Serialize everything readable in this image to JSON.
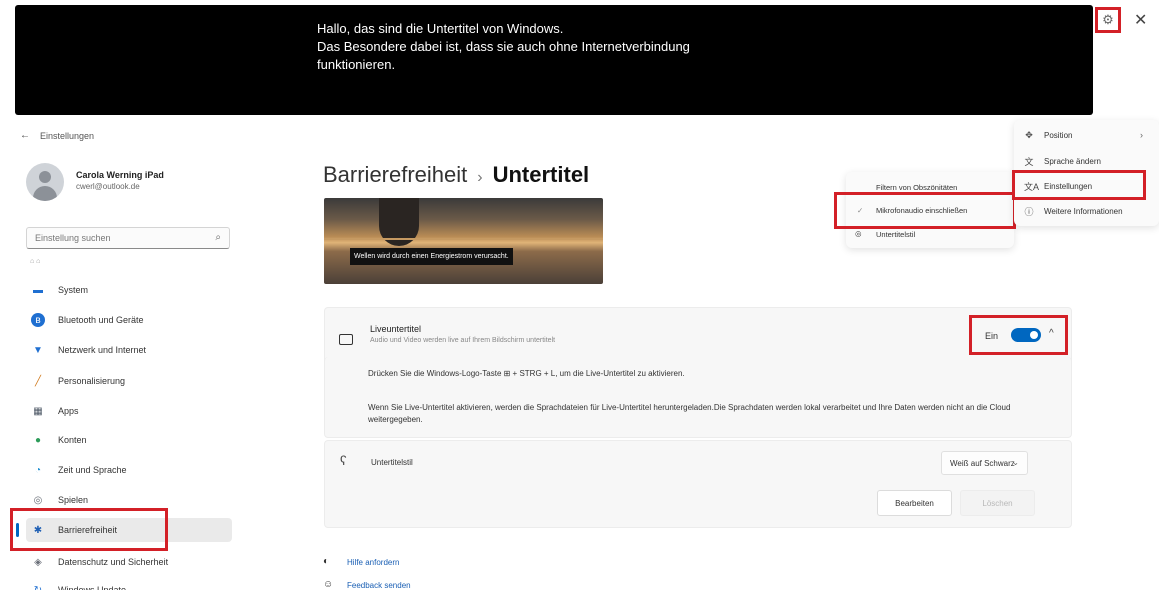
{
  "caption": {
    "lines": [
      "Hallo, das sind die Untertitel von Windows.",
      "Das Besondere dabei ist, dass sie auch ohne Internetverbindung",
      "funktionieren."
    ],
    "gear_icon": "⚙",
    "close_icon": "✕"
  },
  "window": {
    "back_icon": "←",
    "title": "Einstellungen"
  },
  "user": {
    "name": "Carola Werning iPad",
    "email": "cwerl@outlook.de"
  },
  "search": {
    "placeholder": "Einstellung suchen",
    "icon": "⌕"
  },
  "sidebar": {
    "cut_item": "⌂ ⌂",
    "items": [
      {
        "label": "System",
        "icon": "▬",
        "color": "#1f6fd1"
      },
      {
        "label": "Bluetooth und Geräte",
        "icon": "ʙ",
        "color": "#1f6fd1"
      },
      {
        "label": "Netzwerk und Internet",
        "icon": "▼",
        "color": "#1f6fd1"
      },
      {
        "label": "Personalisierung",
        "icon": "╱",
        "color": "#d17b1f"
      },
      {
        "label": "Apps",
        "icon": "▦",
        "color": "#4a5563"
      },
      {
        "label": "Konten",
        "icon": "●",
        "color": "#2d9c5a"
      },
      {
        "label": "Zeit und Sprache",
        "icon": "◔",
        "color": "#1f8fd1"
      },
      {
        "label": "Spielen",
        "icon": "◎",
        "color": "#6a6f78"
      },
      {
        "label": "Barrierefreiheit",
        "icon": "✱",
        "color": "#1f5fb4"
      },
      {
        "label": "Datenschutz und Sicherheit",
        "icon": "◈",
        "color": "#6a6f78"
      },
      {
        "label": "Windows Update",
        "icon": "↻",
        "color": "#1f6fd1"
      }
    ]
  },
  "main": {
    "breadcrumb_parent": "Barrierefreiheit",
    "breadcrumb_sep": "›",
    "breadcrumb_current": "Untertitel",
    "preview_caption": "Wellen wird durch einen Energiestrom verursacht.",
    "live": {
      "title": "Liveuntertitel",
      "subtitle": "Audio und Video werden live auf Ihrem Bildschirm untertitelt",
      "toggle_label": "Ein",
      "toggle_on": true,
      "chevron": "^"
    },
    "text1": "Drücken Sie die Windows-Logo-Taste ⊞ + STRG + L, um die Live-Untertitel zu aktivieren.",
    "text2": "Wenn Sie Live-Untertitel aktivieren, werden die Sprachdateien für Live-Untertitel heruntergeladen.Die Sprachdaten werden lokal verarbeitet und Ihre Daten werden nicht an die Cloud weitergegeben.",
    "style": {
      "icon": "ʕ",
      "label": "Untertitelstil",
      "value": "Weiß auf Schwarz",
      "chevron": "⌄",
      "edit": "Bearbeiten",
      "delete": "Löschen"
    },
    "help_link": "Hilfe anfordern",
    "help_icon": "◐",
    "feedback_link": "Feedback senden",
    "feedback_icon": "☺"
  },
  "submenu": {
    "items": [
      {
        "label": "Filtern von Obszönitäten",
        "check": ""
      },
      {
        "label": "Mikrofonaudio einschließen",
        "check": "✓"
      },
      {
        "label": "Untertitelstil",
        "check": "◎"
      }
    ]
  },
  "menu": {
    "items": [
      {
        "label": "Position",
        "icon": "✥"
      },
      {
        "label": "Sprache ändern",
        "icon": "文"
      },
      {
        "label": "Einstellungen",
        "icon": "文A"
      },
      {
        "label": "Weitere Informationen",
        "icon": "ⓘ"
      }
    ],
    "chevron": "›"
  }
}
